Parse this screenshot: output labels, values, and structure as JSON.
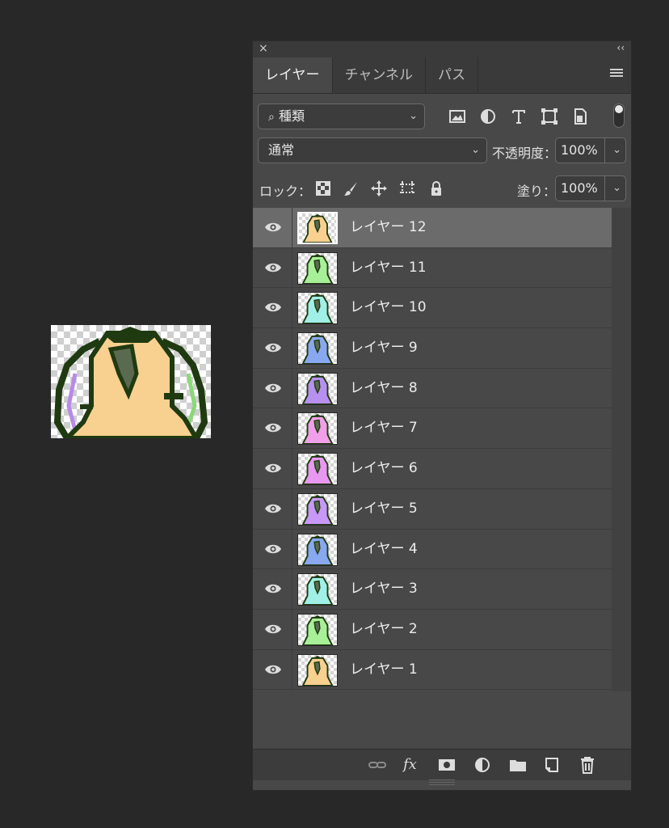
{
  "panel": {
    "close_label": "×",
    "collapse_label": "‹‹",
    "tabs": [
      {
        "label": "レイヤー",
        "active": true
      },
      {
        "label": "チャンネル",
        "active": false
      },
      {
        "label": "パス",
        "active": false
      }
    ],
    "menu_icon": "hamburger-menu-icon"
  },
  "filter": {
    "kind_label": "種類",
    "search_icon": "search-icon",
    "icons": [
      "image-filter-icon",
      "adjustment-filter-icon",
      "type-filter-icon",
      "shape-filter-icon",
      "smart-object-filter-icon"
    ]
  },
  "blend": {
    "mode": "通常",
    "opacity_label": "不透明度：",
    "opacity_value": "100%"
  },
  "lock": {
    "label": "ロック：",
    "icons": [
      "lock-transparent-pixels-icon",
      "lock-image-pixels-icon",
      "lock-position-icon",
      "lock-artboard-icon",
      "lock-all-icon"
    ],
    "fill_label": "塗り：",
    "fill_value": "100%"
  },
  "layers": [
    {
      "name": "レイヤー 12",
      "color": "#f8d090",
      "selected": true
    },
    {
      "name": "レイヤー 11",
      "color": "#a8f098",
      "selected": false
    },
    {
      "name": "レイヤー 10",
      "color": "#a0f0e8",
      "selected": false
    },
    {
      "name": "レイヤー 9",
      "color": "#8aa8f0",
      "selected": false
    },
    {
      "name": "レイヤー 8",
      "color": "#b890f0",
      "selected": false
    },
    {
      "name": "レイヤー 7",
      "color": "#f0a0e8",
      "selected": false
    },
    {
      "name": "レイヤー 6",
      "color": "#e898f0",
      "selected": false
    },
    {
      "name": "レイヤー 5",
      "color": "#c898f8",
      "selected": false
    },
    {
      "name": "レイヤー 4",
      "color": "#88a8f0",
      "selected": false
    },
    {
      "name": "レイヤー 3",
      "color": "#a0f0e8",
      "selected": false
    },
    {
      "name": "レイヤー 2",
      "color": "#a8f098",
      "selected": false
    },
    {
      "name": "レイヤー 1",
      "color": "#f8d090",
      "selected": false
    }
  ],
  "bottom_bar": {
    "icons": [
      "link-layers-icon",
      "fx-icon",
      "layer-mask-icon",
      "adjustment-layer-icon",
      "group-folder-icon",
      "new-layer-icon",
      "trash-icon"
    ],
    "fx_label": "fx"
  },
  "canvas": {
    "bird_color": "#f8d090",
    "outline_color": "#1f3a10",
    "beak_color": "#5a6a50"
  }
}
